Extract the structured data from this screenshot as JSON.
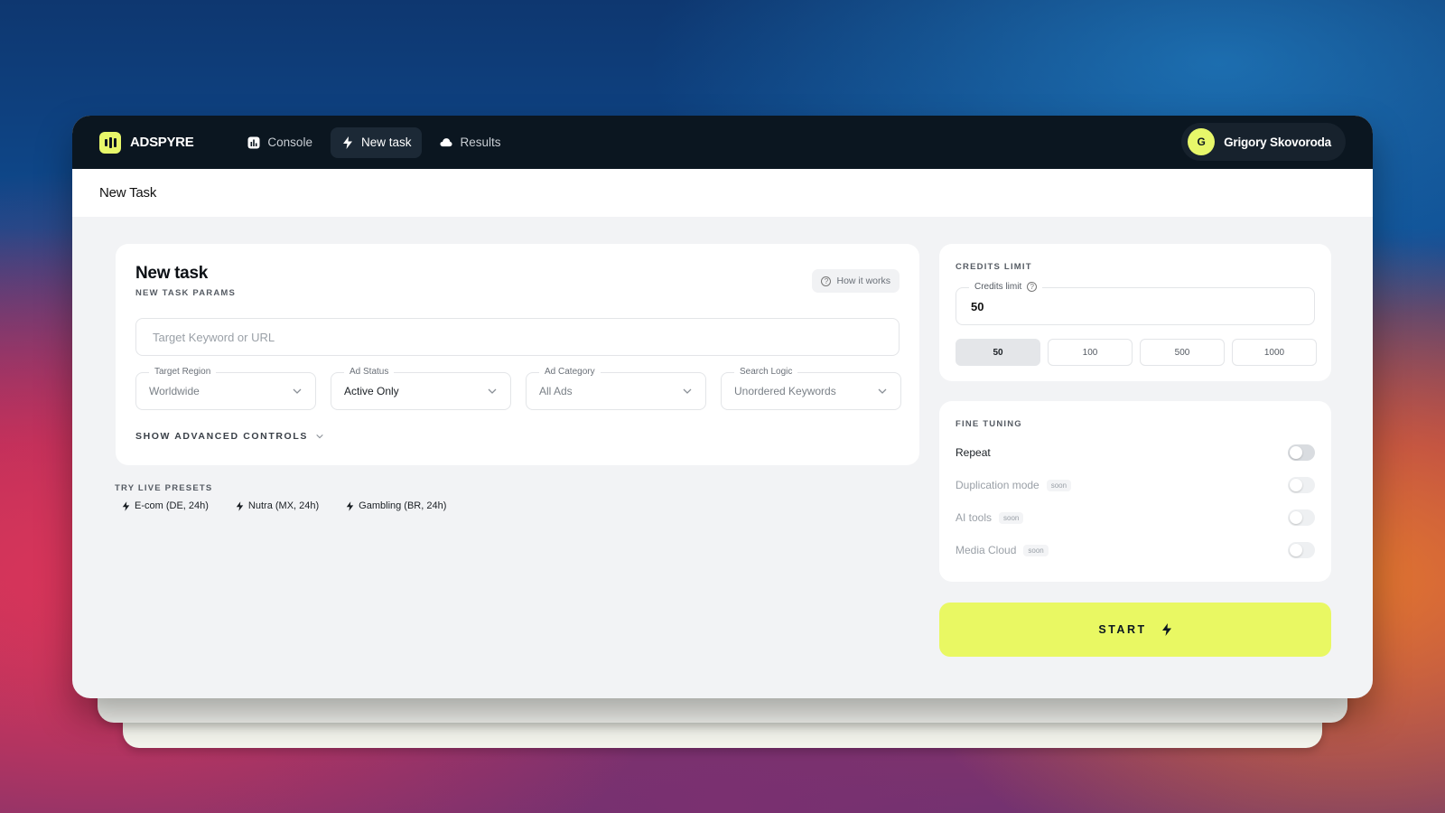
{
  "app": {
    "name": "ADSPYRE"
  },
  "nav": {
    "items": [
      {
        "label": "Console",
        "icon": "chart-icon"
      },
      {
        "label": "New task",
        "icon": "bolt-icon"
      },
      {
        "label": "Results",
        "icon": "cloud-icon"
      }
    ],
    "active": "New task"
  },
  "user": {
    "initial": "G",
    "name": "Grigory Skovoroda"
  },
  "page": {
    "title": "New Task"
  },
  "task": {
    "title": "New task",
    "subtitle": "NEW TASK PARAMS",
    "how_it_works": "How it works",
    "target_placeholder": "Target Keyword or URL",
    "target_value": "",
    "selects": [
      {
        "label": "Target Region",
        "value": "Worldwide"
      },
      {
        "label": "Ad Status",
        "value": "Active Only"
      },
      {
        "label": "Ad Category",
        "value": "All Ads"
      },
      {
        "label": "Search Logic",
        "value": "Unordered Keywords"
      }
    ],
    "advanced": "SHOW ADVANCED CONTROLS"
  },
  "presets": {
    "title": "TRY LIVE PRESETS",
    "items": [
      "E-com (DE, 24h)",
      "Nutra (MX, 24h)",
      "Gambling (BR, 24h)"
    ]
  },
  "credits": {
    "section_title": "CREDITS LIMIT",
    "field_label": "Credits limit",
    "value": "50",
    "options": [
      "50",
      "100",
      "500",
      "1000"
    ],
    "selected": "50"
  },
  "fine_tuning": {
    "section_title": "FINE TUNING",
    "items": [
      {
        "label": "Repeat",
        "badge": "",
        "enabled": false
      },
      {
        "label": "Duplication mode",
        "badge": "soon",
        "enabled": false
      },
      {
        "label": "AI tools",
        "badge": "soon",
        "enabled": false
      },
      {
        "label": "Media Cloud",
        "badge": "soon",
        "enabled": false
      }
    ]
  },
  "start": {
    "label": "START"
  },
  "colors": {
    "accent": "#e9f863",
    "topbar": "#0b1620"
  }
}
